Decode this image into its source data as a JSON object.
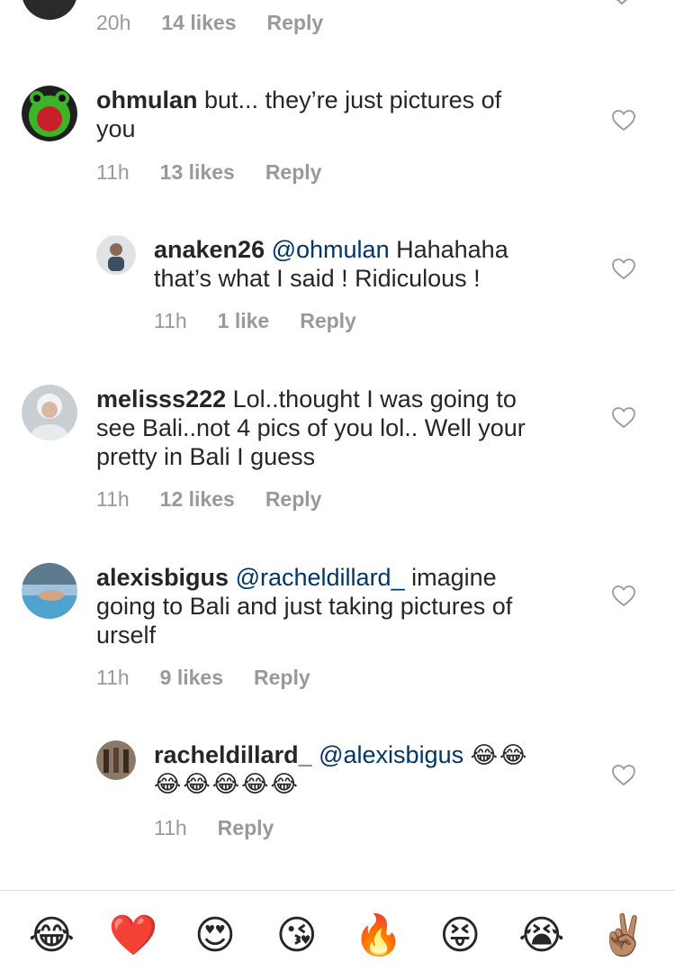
{
  "top_comment": {
    "time": "20h",
    "likes": "14 likes",
    "reply": "Reply"
  },
  "comments": [
    {
      "username": "ohmulan",
      "text_lines": [
        "but... they’re just pictures of",
        "you"
      ],
      "time": "11h",
      "likes": "13 likes",
      "reply": "Reply",
      "avatar_color": "#2f9e1f"
    },
    {
      "username": "anaken26",
      "mention": "@ohmulan",
      "text_lines": [
        " Hahahaha",
        "that’s what I said !  Ridiculous !"
      ],
      "time": "11h",
      "likes": "1 like",
      "reply": "Reply",
      "avatar_color": "#5a6b7a"
    },
    {
      "username": "melisss222",
      "text_lines": [
        "Lol..thought I was going to",
        "see Bali..not 4 pics of you lol.. Well your",
        "pretty in Bali I guess"
      ],
      "time": "11h",
      "likes": "12 likes",
      "reply": "Reply",
      "avatar_color": "#b8c2c9"
    },
    {
      "username": "alexisbigus",
      "mention": "@racheldillard_",
      "text_lines": [
        " imagine",
        "going to Bali and just taking pictures of",
        "urself"
      ],
      "time": "11h",
      "likes": "9 likes",
      "reply": "Reply",
      "avatar_color": "#7da7c4"
    },
    {
      "username": "racheldillard_",
      "mention": "@alexisbigus",
      "text_lines": [
        "😂😂",
        "😂😂😂😂😂"
      ],
      "time": "11h",
      "reply": "Reply",
      "avatar_color": "#6b5240"
    }
  ],
  "emoji_bar": [
    "😂",
    "❤️",
    "😍",
    "😘",
    "🔥",
    "😝",
    "😭",
    "✌🏽"
  ],
  "colors": {
    "meta_gray": "#999999",
    "mention_blue": "#003569",
    "heart_red": "#ed1c24"
  }
}
